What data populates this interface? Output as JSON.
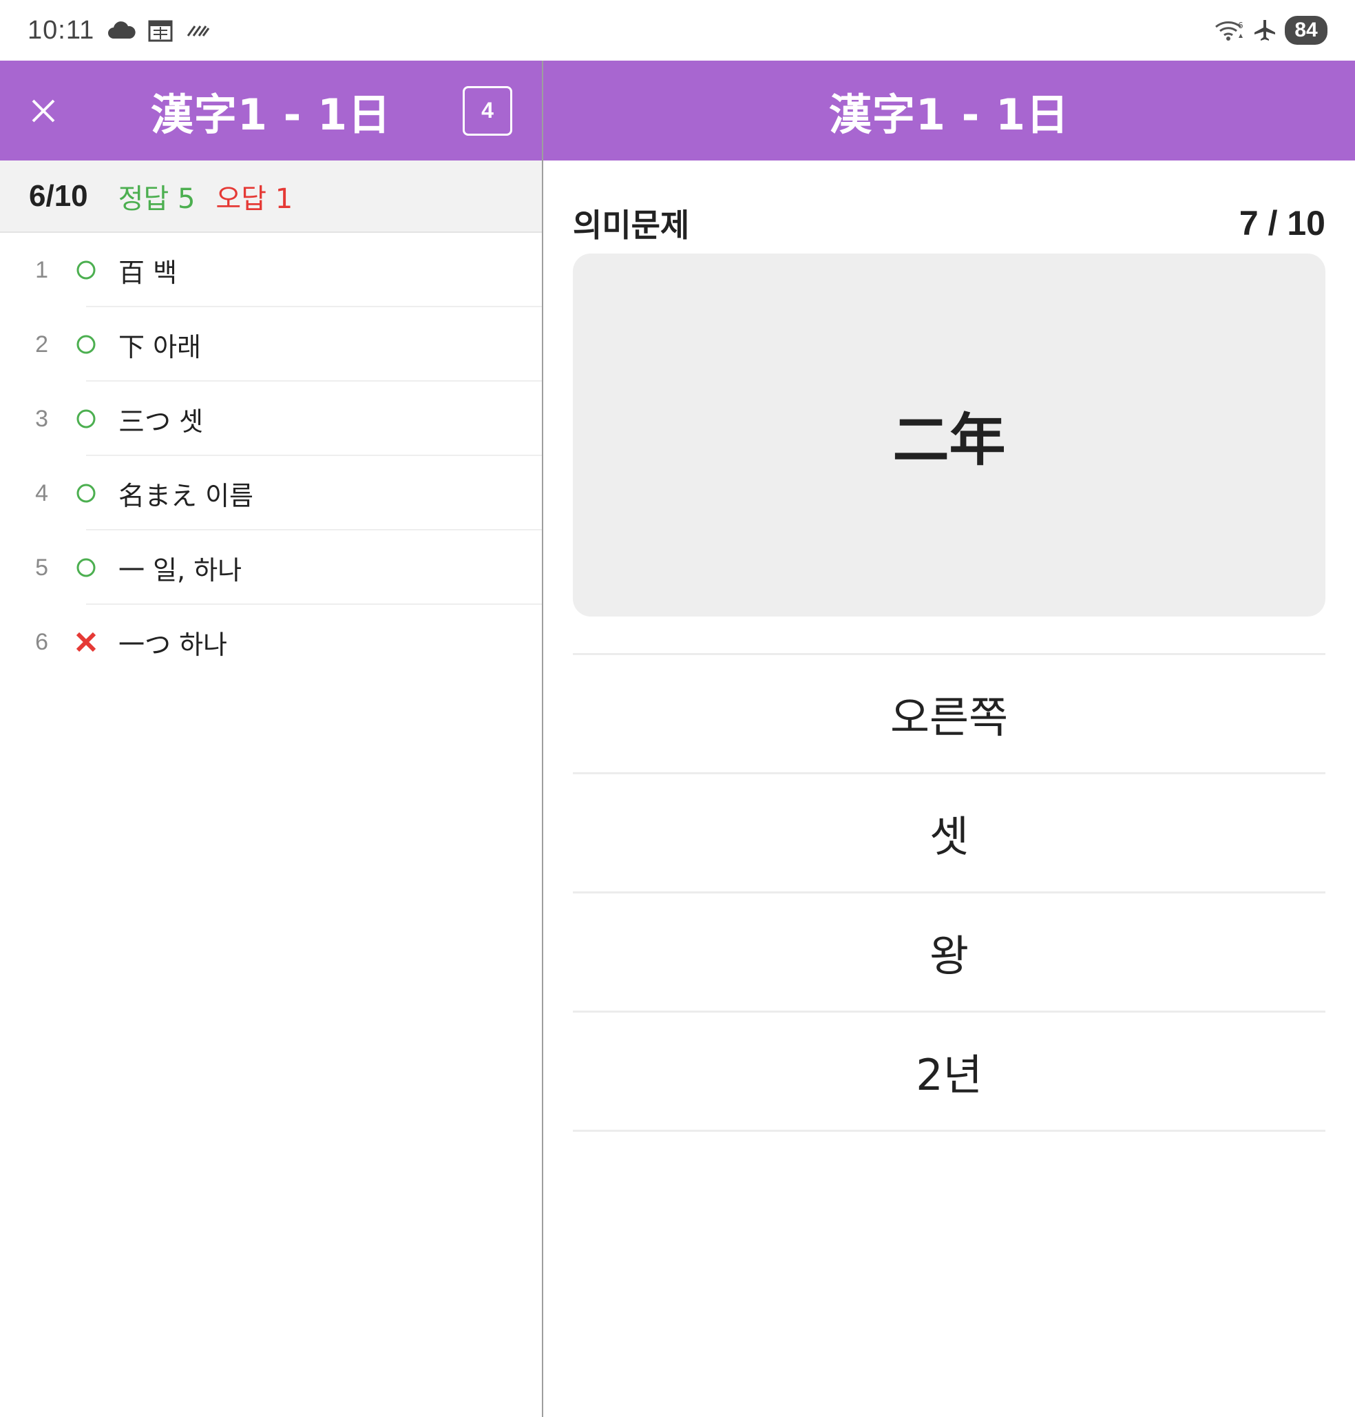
{
  "status_bar": {
    "time": "10:11",
    "left_icons": [
      "cloud-icon",
      "calendar-icon",
      "rain-icon"
    ],
    "right_icons": [
      "wifi-icon",
      "airplane-mode-icon"
    ],
    "battery": "84"
  },
  "left_panel": {
    "title": "漢字1 - 1日",
    "count_badge": "4",
    "score": {
      "progress": "6/10",
      "correct_label": "정답",
      "correct_count": "5",
      "wrong_label": "오답",
      "wrong_count": "1",
      "correct_color": "#4caf50",
      "wrong_color": "#e53935"
    },
    "results": [
      {
        "num": "1",
        "mark": "correct",
        "text": "百  백"
      },
      {
        "num": "2",
        "mark": "correct",
        "text": "下  아래"
      },
      {
        "num": "3",
        "mark": "correct",
        "text": "三つ  셋"
      },
      {
        "num": "4",
        "mark": "correct",
        "text": "名まえ  이름"
      },
      {
        "num": "5",
        "mark": "correct",
        "text": "一  일, 하나"
      },
      {
        "num": "6",
        "mark": "wrong",
        "text": "一つ  하나"
      }
    ]
  },
  "right_panel": {
    "title": "漢字1 - 1日",
    "question_type": "의미문제",
    "progress": "7 / 10",
    "word": "二年",
    "choices": [
      "오른쪽",
      "셋",
      "왕",
      "2년"
    ]
  },
  "colors": {
    "appbar": "#a866d0",
    "card": "#eeeeee"
  }
}
